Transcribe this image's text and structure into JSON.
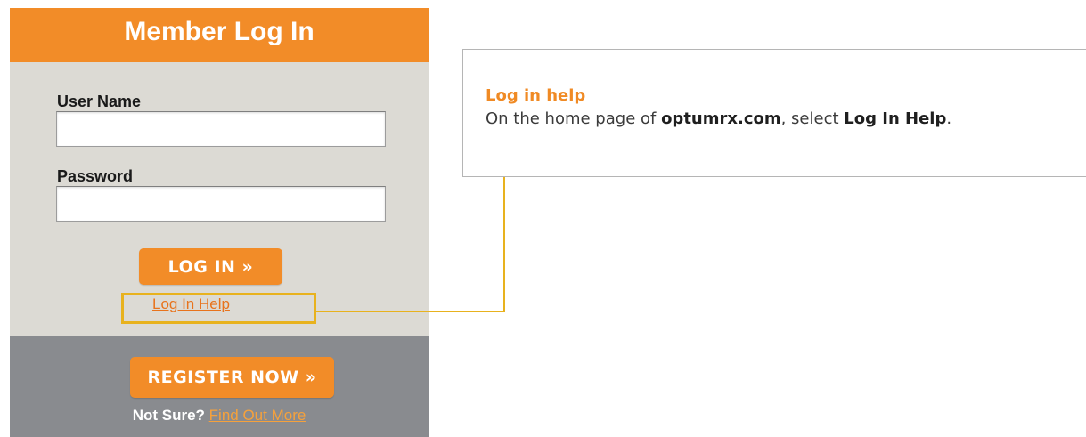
{
  "login": {
    "title": "Member Log In",
    "username_label": "User Name",
    "username_value": "",
    "password_label": "Password",
    "password_value": "",
    "login_button": "LOG IN »",
    "help_link": "Log In Help",
    "register_button": "REGISTER NOW »",
    "not_sure": "Not Sure?",
    "find_out_more": "Find Out More"
  },
  "callout": {
    "title": "Log in help",
    "text_before": "On the home page of ",
    "site": "optumrx.com",
    "text_middle": ", select ",
    "target": "Log In Help",
    "text_after": "."
  },
  "colors": {
    "brand_orange": "#f28c28",
    "panel_gray": "#dcdad4",
    "footer_gray": "#898b8f",
    "highlight_yellow": "#e8b21e"
  }
}
